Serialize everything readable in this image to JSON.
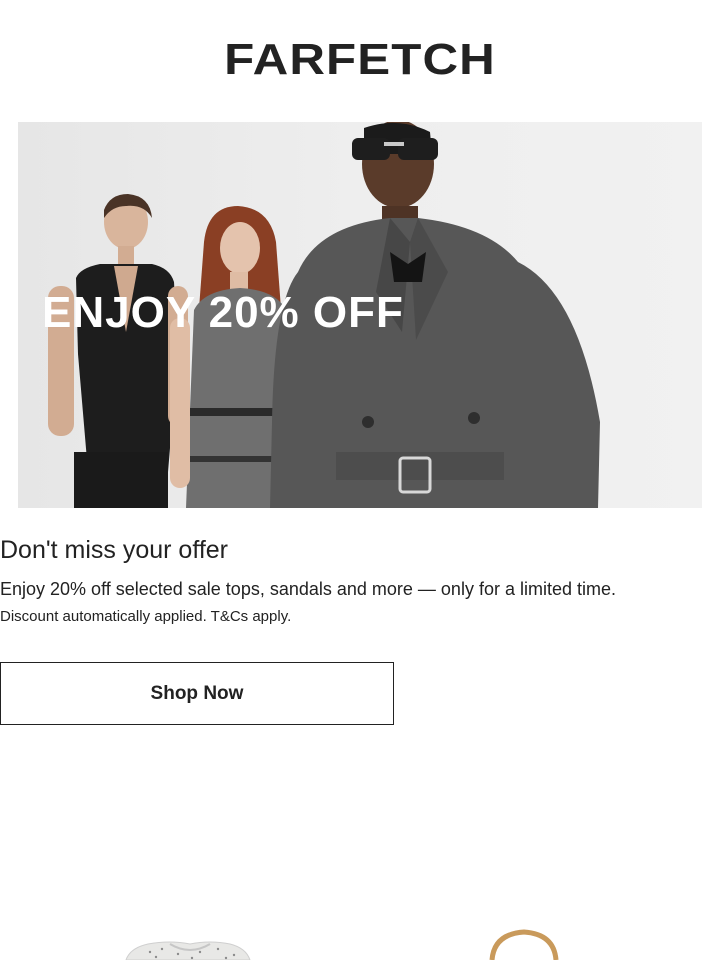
{
  "brand": {
    "logo_text": "FARFETCH"
  },
  "hero": {
    "overlay_text": "ENJOY 20% OFF"
  },
  "content": {
    "headline": "Don't miss your offer",
    "body": "Enjoy 20% off selected sale tops, sandals and more — only for a limited time.",
    "disclaimer": "Discount automatically applied. T&Cs apply."
  },
  "cta": {
    "label": "Shop Now"
  },
  "colors": {
    "text": "#222222",
    "background": "#ffffff",
    "hero_background": "#ececec"
  },
  "products": [
    {
      "icon": "knit-top-image"
    },
    {
      "icon": "bag-handle-image"
    }
  ]
}
